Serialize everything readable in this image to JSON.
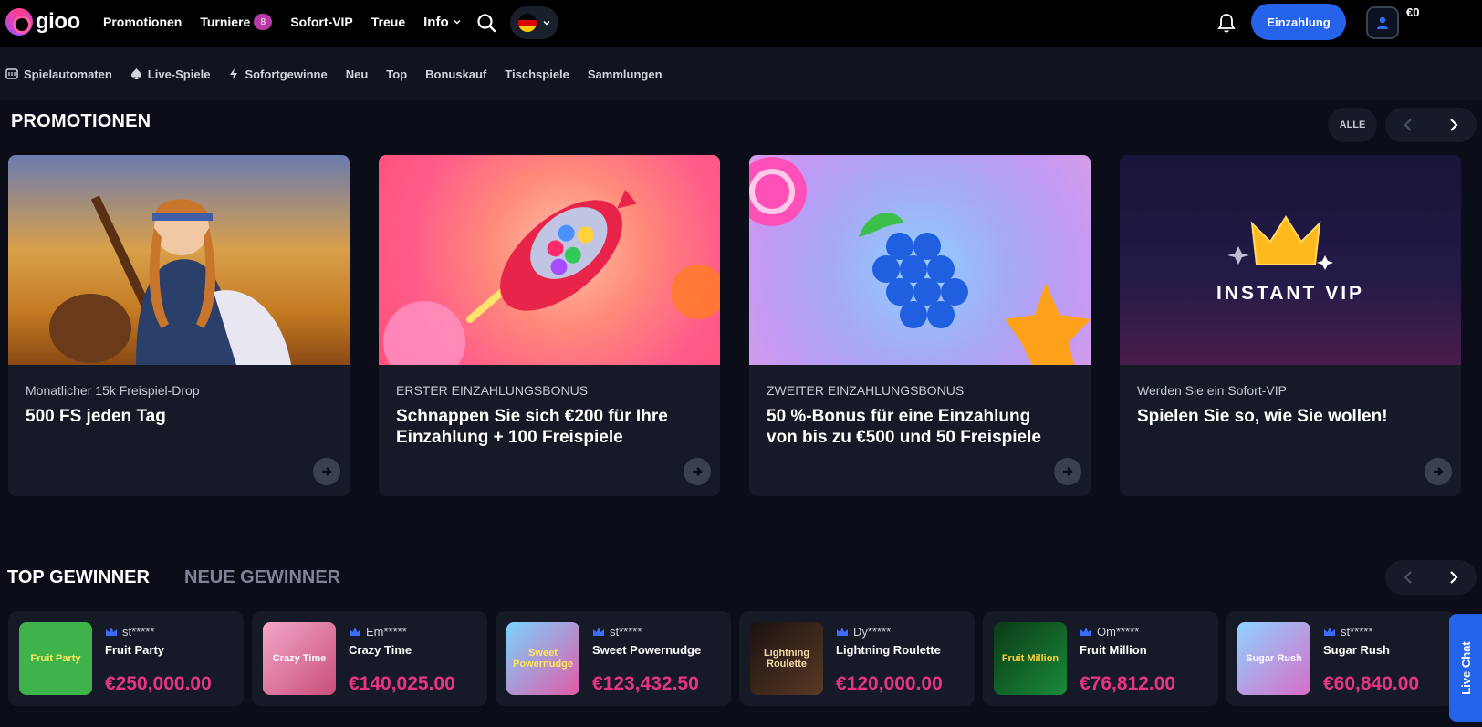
{
  "brand": {
    "name": "gioo"
  },
  "nav": {
    "promotions": "Promotionen",
    "tournaments": "Turniere",
    "tournaments_count": "8",
    "instant_vip": "Sofort-VIP",
    "loyalty": "Treue",
    "info": "Info"
  },
  "header": {
    "deposit_label": "Einzahlung",
    "balance": "€0"
  },
  "categories": [
    "Spielautomaten",
    "Live-Spiele",
    "Sofortgewinne",
    "Neu",
    "Top",
    "Bonuskauf",
    "Tischspiele",
    "Sammlungen"
  ],
  "promotions": {
    "title": "PROMOTIONEN",
    "all_label": "ALLE",
    "cards": [
      {
        "subtitle": "Monatlicher 15k Freispiel-Drop",
        "title": "500 FS jeden Tag"
      },
      {
        "subtitle": "ERSTER EINZAHLUNGSBONUS",
        "title": "Schnappen Sie sich €200 für Ihre Einzahlung + 100 Freispiele"
      },
      {
        "subtitle": "ZWEITER EINZAHLUNGSBONUS",
        "title": "50 %-Bonus für eine Einzahlung von bis zu €500 und 50 Freispiele"
      },
      {
        "subtitle": "Werden Sie ein Sofort-VIP",
        "title": "Spielen Sie so, wie Sie wollen!",
        "image_text": "INSTANT VIP"
      }
    ]
  },
  "winners": {
    "tab_top": "TOP GEWINNER",
    "tab_new": "NEUE GEWINNER",
    "items": [
      {
        "user": "st*****",
        "game": "Fruit Party",
        "amount": "€250,000.00",
        "thumb_text": "Fruit Party",
        "thumb_color": "#3fb34a"
      },
      {
        "user": "Em*****",
        "game": "Crazy Time",
        "amount": "€140,025.00",
        "thumb_text": "Crazy Time",
        "thumb_color": "#c94d7b"
      },
      {
        "user": "st*****",
        "game": "Sweet Powernudge",
        "amount": "€123,432.50",
        "thumb_text": "Sweet Powernudge",
        "thumb_color": "#e15aa6"
      },
      {
        "user": "Dy*****",
        "game": "Lightning Roulette",
        "amount": "€120,000.00",
        "thumb_text": "Lightning Roulette",
        "thumb_color": "#2a1d18"
      },
      {
        "user": "Om*****",
        "game": "Fruit Million",
        "amount": "€76,812.00",
        "thumb_text": "Fruit Million",
        "thumb_color": "#0f5b23"
      },
      {
        "user": "st*****",
        "game": "Sugar Rush",
        "amount": "€60,840.00",
        "thumb_text": "Sugar Rush",
        "thumb_color": "#d86cc9"
      }
    ]
  },
  "live_chat": "Live Chat",
  "colors": {
    "accent": "#2563eb",
    "amount": "#e8357f",
    "badge": "#b83aa6"
  }
}
